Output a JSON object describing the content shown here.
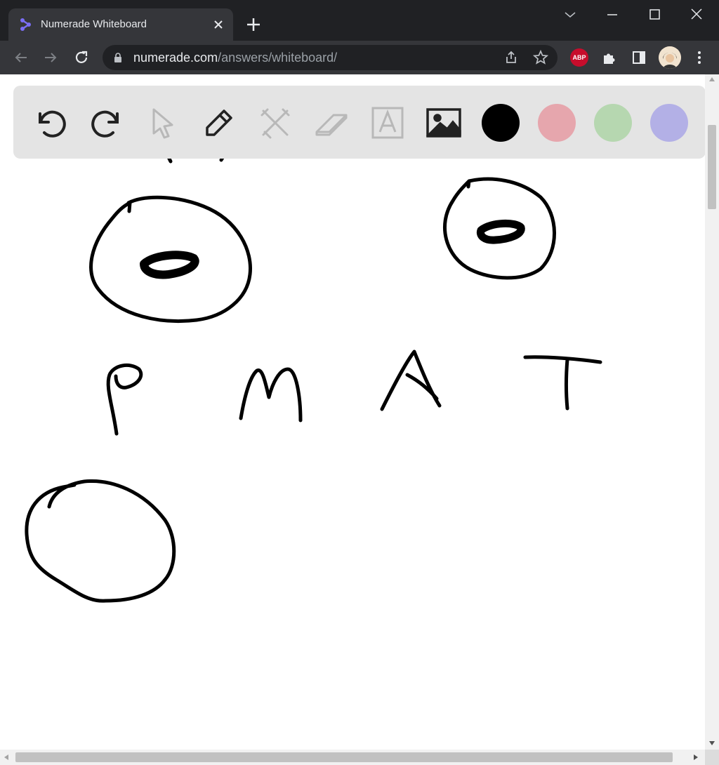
{
  "browser": {
    "tab_title": "Numerade Whiteboard",
    "url_host": "numerade.com",
    "url_path": "/answers/whiteboard/",
    "extension_badge": "ABP"
  },
  "whiteboard": {
    "tools": [
      "undo-icon",
      "redo-icon",
      "select-icon",
      "pencil-icon",
      "tools-icon",
      "eraser-icon",
      "text-tool-icon",
      "image-icon"
    ],
    "colors": [
      "#000000",
      "#e6a6ad",
      "#b6d7b0",
      "#b3b0e6"
    ],
    "selected_color": "#000000"
  }
}
